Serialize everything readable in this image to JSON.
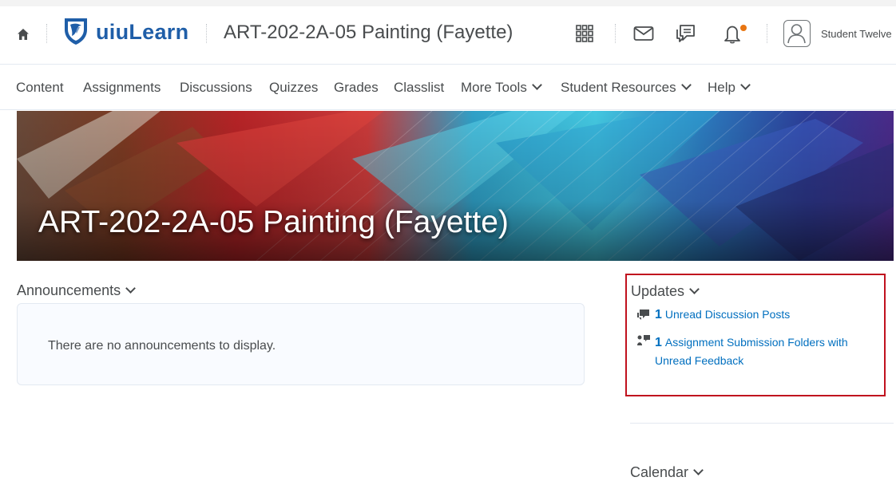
{
  "header": {
    "brand": "uiuLearn",
    "course_title": "ART-202-2A-05 Painting (Fayette)",
    "user_name": "Student Twelve"
  },
  "nav": {
    "items": [
      {
        "label": "Content"
      },
      {
        "label": "Assignments"
      },
      {
        "label": "Discussions"
      },
      {
        "label": "Quizzes"
      },
      {
        "label": "Grades"
      },
      {
        "label": "Classlist"
      },
      {
        "label": "More Tools"
      },
      {
        "label": "Student Resources"
      },
      {
        "label": "Help"
      }
    ]
  },
  "banner": {
    "title": "ART-202-2A-05 Painting (Fayette)"
  },
  "announcements": {
    "heading": "Announcements",
    "empty_text": "There are no announcements to display."
  },
  "updates": {
    "heading": "Updates",
    "items": [
      {
        "count": "1",
        "label": "Unread Discussion Posts"
      },
      {
        "count": "1",
        "label_line1": "Assignment Submission Folders with",
        "label_line2": "Unread Feedback"
      }
    ]
  },
  "calendar": {
    "heading": "Calendar"
  },
  "colors": {
    "brand": "#1f5ea8",
    "link": "#006fbf",
    "highlight_border": "#c0111e",
    "notification_dot": "#e87511"
  },
  "icons": {
    "home": "home-icon",
    "logo": "shield-logo-icon",
    "apps": "grid-icon",
    "mail": "mail-icon",
    "chat": "chat-icon",
    "bell": "bell-icon",
    "user": "user-icon",
    "discussion": "discussion-icon",
    "assignment": "assignment-feedback-icon"
  }
}
